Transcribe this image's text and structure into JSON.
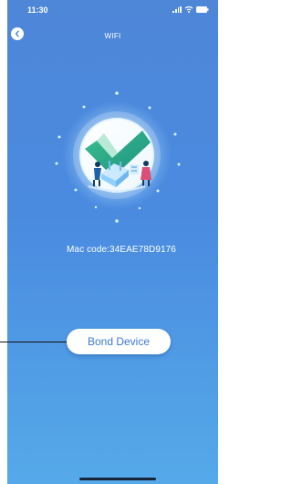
{
  "status_bar": {
    "time": "11:30",
    "icons": [
      "signal-icon",
      "wifi-icon",
      "battery-icon"
    ]
  },
  "header": {
    "title": "WIFI",
    "back_icon": "chevron-left-icon"
  },
  "success": {
    "icon": "checkmark-icon",
    "illustration": "router-setup-illustration",
    "mac_label": "Mac code:",
    "mac_value": "34EAE78D9176"
  },
  "actions": {
    "bond_label": "Bond Device"
  },
  "colors": {
    "background_top": "#4e86d8",
    "background_bottom": "#55a9e9",
    "check_green": "#2fb08f",
    "button_text": "#3d78d5"
  }
}
